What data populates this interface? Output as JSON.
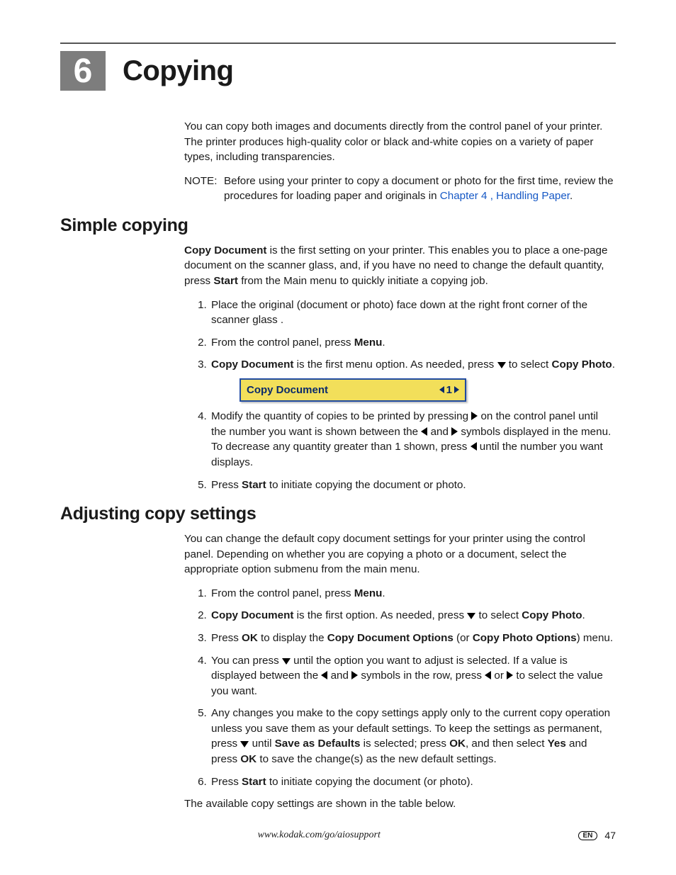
{
  "chapter": {
    "number": "6",
    "title": "Copying"
  },
  "intro": "You can copy both images and documents directly from the control panel of your printer. The printer produces high-quality color or black and-white copies on a variety of paper types, including transparencies.",
  "note": {
    "label": "NOTE:",
    "before_link": "Before using your printer to copy a document or photo for the first time, review the procedures for loading paper and originals in ",
    "link": "Chapter 4 , Handling Paper",
    "after_link": "."
  },
  "simple": {
    "heading": "Simple copying",
    "intro_parts": {
      "p1a": "Copy Document",
      "p1b": " is the first setting on your printer. This enables you to place a one-page document on the scanner glass, and, if you have no need to change the default quantity, press ",
      "p1c": "Start",
      "p1d": " from the Main menu to quickly initiate a copying job."
    },
    "steps": {
      "s1": "Place the original (document or photo) face down at the right front corner of the scanner glass .",
      "s2a": "From the control panel, press ",
      "s2b": "Menu",
      "s2c": ".",
      "s3a": "Copy Document",
      "s3b": " is the first menu option. As needed, press ",
      "s3c": " to select ",
      "s3d": "Copy Photo",
      "s3e": ".",
      "s4a": "Modify the quantity of copies to be printed by pressing ",
      "s4b": " on the control panel until the number you want is shown between the ",
      "s4c": " and ",
      "s4d": " symbols displayed in the menu. To decrease any quantity greater than 1 shown, press ",
      "s4e": " until the number you want displays.",
      "s5a": "Press ",
      "s5b": "Start",
      "s5c": " to initiate copying the document or photo."
    },
    "lcd": {
      "label": "Copy Document",
      "qty": "1"
    }
  },
  "adjust": {
    "heading": "Adjusting copy settings",
    "intro": "You can change the default copy document settings for your printer using the control panel. Depending on whether you are copying a photo or a document, select the appropriate option submenu from the main menu.",
    "steps": {
      "s1a": "From the control panel, press ",
      "s1b": "Menu",
      "s1c": ".",
      "s2a": "Copy Document",
      "s2b": " is the first option. As needed, press ",
      "s2c": " to select ",
      "s2d": "Copy Photo",
      "s2e": ".",
      "s3a": "Press ",
      "s3b": "OK",
      "s3c": " to display the ",
      "s3d": "Copy Document Options",
      "s3e": " (or ",
      "s3f": "Copy Photo Options",
      "s3g": ") menu.",
      "s4a": "You can press ",
      "s4b": " until the option you want to adjust is selected. If a value is displayed between the ",
      "s4c": " and ",
      "s4d": " symbols in the row, press ",
      "s4e": " or ",
      "s4f": " to select the value you want.",
      "s5a": "Any changes you make to the copy settings apply only to the current copy operation unless you save them as your default settings. To keep the settings as permanent, press ",
      "s5b": " until ",
      "s5c": "Save as Defaults",
      "s5d": " is selected; press ",
      "s5e": "OK",
      "s5f": ", and then select ",
      "s5g": "Yes",
      "s5h": " and press ",
      "s5i": "OK",
      "s5j": " to save the change(s) as the new default settings.",
      "s6a": "Press ",
      "s6b": "Start",
      "s6c": " to initiate copying the document (or photo)."
    },
    "outro": "The available copy settings are shown in the table below."
  },
  "footer": {
    "url": "www.kodak.com/go/aiosupport",
    "lang": "EN",
    "page": "47"
  }
}
